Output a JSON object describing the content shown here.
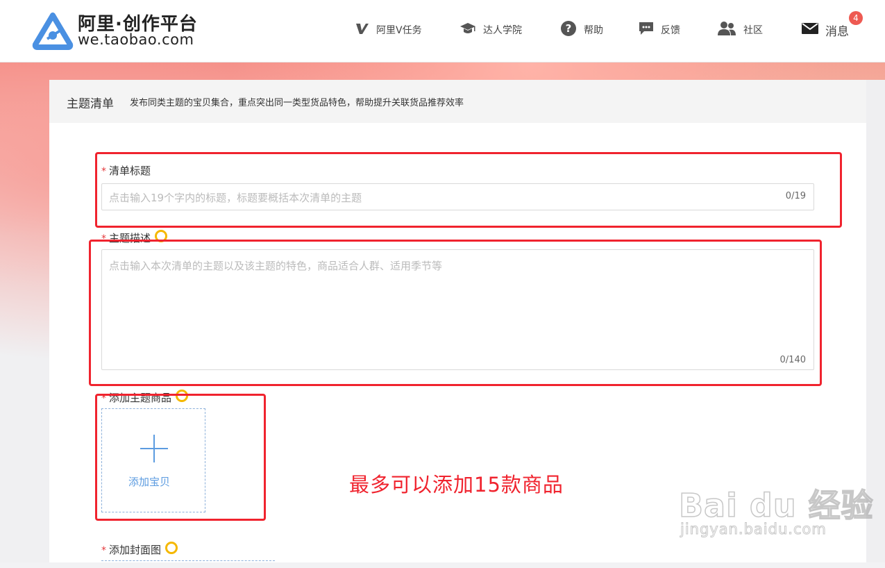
{
  "header": {
    "logo_title": "阿里·创作平台",
    "logo_url": "we.taobao.com",
    "nav": [
      {
        "label": "阿里V任务",
        "icon": "v-task-icon"
      },
      {
        "label": "达人学院",
        "icon": "graduation-cap-icon"
      },
      {
        "label": "帮助",
        "icon": "help-icon"
      },
      {
        "label": "反馈",
        "icon": "feedback-icon"
      },
      {
        "label": "社区",
        "icon": "community-icon"
      },
      {
        "label": "消息",
        "icon": "mail-icon"
      }
    ],
    "message_badge": "4"
  },
  "page": {
    "title": "主题清单",
    "description": "发布同类主题的宝贝集合，重点突出同一类型货品特色，帮助提升关联货品推荐效率"
  },
  "form": {
    "required_mark": "*",
    "list_title": {
      "label": "清单标题",
      "placeholder": "点击输入19个字内的标题，标题要概括本次清单的主题",
      "counter": "0/19"
    },
    "theme_description": {
      "label": "主题描述",
      "placeholder": "点击输入本次清单的主题以及该主题的特色，商品适合人群、适用季节等",
      "counter": "0/140"
    },
    "add_products": {
      "label": "添加主题商品",
      "button_label": "添加宝贝"
    },
    "add_cover": {
      "label": "添加封面图"
    }
  },
  "annotation": {
    "text": "最多可以添加15款商品",
    "color": "#f0232e"
  },
  "watermark": {
    "text": "Bai du 经验",
    "sub": "jingyan.baidu.com"
  },
  "colors": {
    "accent_blue": "#5b9be0",
    "required_red": "#e4393c",
    "badge_red": "#ee5a52",
    "tip_yellow": "#f5b800"
  }
}
